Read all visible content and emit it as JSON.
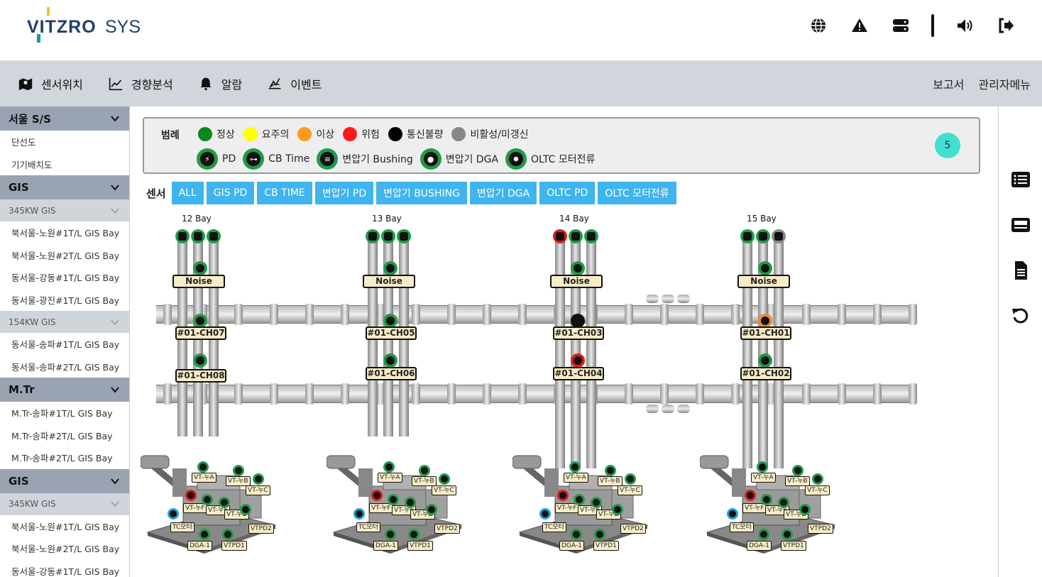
{
  "header": {
    "logo_main": "VITZRO",
    "logo_sub": "SYS",
    "icons": [
      "globe-icon",
      "warning-icon",
      "server-icon",
      "volume-icon",
      "logout-icon"
    ]
  },
  "menu": {
    "items": [
      {
        "label": "센서위치",
        "icon": "map-icon"
      },
      {
        "label": "경향분석",
        "icon": "chart-line-icon"
      },
      {
        "label": "알람",
        "icon": "bell-icon"
      },
      {
        "label": "이벤트",
        "icon": "event-icon"
      }
    ],
    "right": [
      "보고서",
      "관리자메뉴"
    ]
  },
  "sidebar": {
    "groups": [
      {
        "label": "서울 S/S",
        "items": [
          "단선도",
          "기기배치도"
        ]
      },
      {
        "label": "GIS",
        "subs": [
          {
            "label": "345KW GIS",
            "items": [
              "북서울-노원#1T/L GIS Bay",
              "북서울-노원#2T/L GIS Bay",
              "동서울-강동#1T/L GIS Bay",
              "동서울-광진#1T/L GIS Bay"
            ]
          },
          {
            "label": "154KW GIS",
            "items": [
              "동서울-송파#1T/L GIS Bay",
              "동서울-송파#2T/L GIS Bay"
            ]
          }
        ]
      },
      {
        "label": "M.Tr",
        "items": [
          "M.Tr-송파#1T/L GIS Bay",
          "M.Tr-송파#2T/L GIS Bay",
          "M.Tr-송파#2T/L GIS Bay"
        ]
      },
      {
        "label": "GIS",
        "subs": [
          {
            "label": "345KW GIS",
            "items": [
              "북서울-노원#1T/L GIS Bay",
              "북서울-노원#2T/L GIS Bay",
              "동서울-강동#1T/L GIS Bay"
            ]
          }
        ]
      }
    ]
  },
  "legend": {
    "title": "범례",
    "status": [
      {
        "label": "정상",
        "color": "#0a8a1a"
      },
      {
        "label": "요주의",
        "color": "#ffff00"
      },
      {
        "label": "이상",
        "color": "#ff9a1a"
      },
      {
        "label": "위험",
        "color": "#ff1a1a"
      },
      {
        "label": "통신불량",
        "color": "#000000"
      },
      {
        "label": "비활성/미갱신",
        "color": "#888888"
      }
    ],
    "sensors": [
      {
        "label": "PD",
        "icon": "pd-icon"
      },
      {
        "label": "CB Time",
        "icon": "cb-time-icon"
      },
      {
        "label": "변압기 Bushing",
        "icon": "bushing-icon"
      },
      {
        "label": "변압기 DGA",
        "icon": "dga-icon"
      },
      {
        "label": "OLTC 모터전류",
        "icon": "oltc-icon"
      }
    ],
    "refresh_count": "5"
  },
  "sensor_filter": {
    "label": "센서",
    "buttons": [
      "ALL",
      "GIS PD",
      "CB TIME",
      "변압기 PD",
      "변압기 BUSHING",
      "변압기 DGA",
      "OLTC PD",
      "OLTC 모터전류"
    ]
  },
  "bays": [
    {
      "title": "12 Bay",
      "noise": "Noise",
      "ch_top": "#01-CH07",
      "ch_bot": "#01-CH08",
      "cb": [
        "#1f9a4a",
        "#1f9a4a",
        "#1f9a4a"
      ],
      "node_top": "#1f9a4a",
      "node_mid": "#1f9a4a",
      "node_bot": "#1f9a4a"
    },
    {
      "title": "13 Bay",
      "noise": "Noise",
      "ch_top": "#01-CH05",
      "ch_bot": "#01-CH06",
      "cb": [
        "#1f9a4a",
        "#1f9a4a",
        "#1f9a4a"
      ],
      "node_top": "#1f9a4a",
      "node_mid": "#1f9a4a",
      "node_bot": "#1f9a4a"
    },
    {
      "title": "14 Bay",
      "noise": "Noise",
      "ch_top": "#01-CH03",
      "ch_bot": "#01-CH04",
      "cb": [
        "#e01a1a",
        "#1f9a4a",
        "#1f9a4a"
      ],
      "node_top": "#1f9a4a",
      "node_mid": "#111111",
      "node_bot": "#e01a1a"
    },
    {
      "title": "15 Bay",
      "noise": "Noise",
      "ch_top": "#01-CH01",
      "ch_bot": "#01-CH02",
      "cb": [
        "#1f9a4a",
        "#1f9a4a",
        "#888888"
      ],
      "node_top": "#1f9a4a",
      "node_mid": "#f08a2a",
      "node_bot": "#1f9a4a"
    }
  ],
  "transformer_labels": {
    "vt_a": "VT-누A",
    "vt_b": "VT-누B",
    "vt_c": "VT-누C",
    "vt_f": "VT-누F",
    "vt_e": "VT-누E",
    "vt_d": "VT-누D",
    "tc": "TC모터",
    "vtpd2": "VTPD2",
    "dga": "DGA-1",
    "vtpd1": "VTPD1"
  }
}
